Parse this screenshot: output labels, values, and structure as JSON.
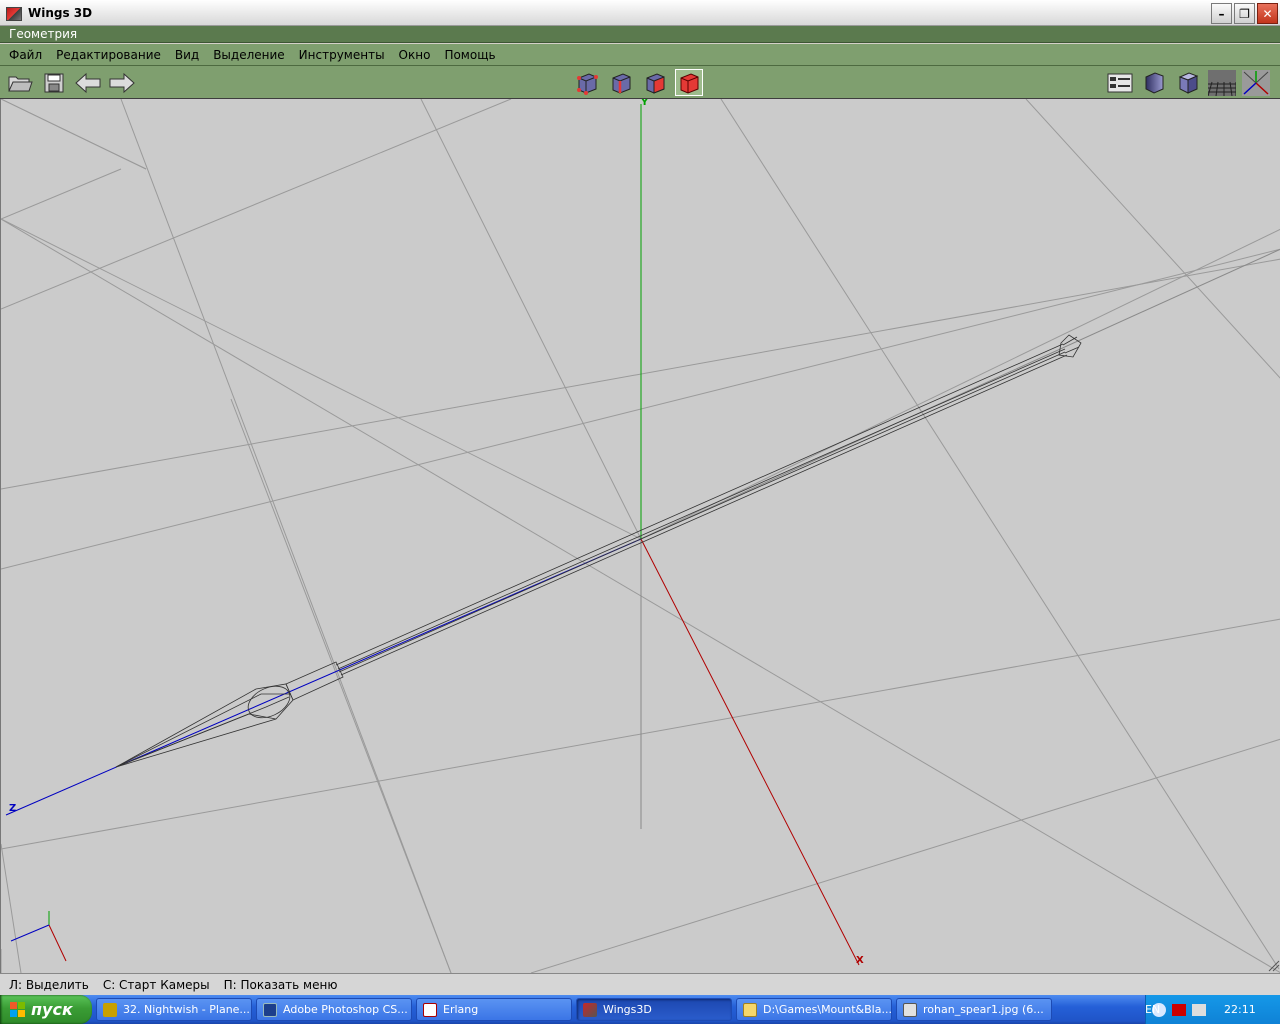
{
  "window": {
    "title": "Wings 3D"
  },
  "geometry_bar": {
    "label": "Геометрия"
  },
  "menu": [
    {
      "label": "Файл"
    },
    {
      "label": "Редактирование"
    },
    {
      "label": "Вид"
    },
    {
      "label": "Выделение"
    },
    {
      "label": "Инструменты"
    },
    {
      "label": "Окно"
    },
    {
      "label": "Помощь"
    }
  ],
  "toolbar": {
    "left_icons": [
      "open-icon",
      "save-icon",
      "undo-icon",
      "redo-icon"
    ],
    "select_modes": [
      "vertex-select-icon",
      "edge-select-icon",
      "face-select-icon",
      "object-select-icon"
    ],
    "active_select_mode": "object-select-icon",
    "right_icons": [
      "outliner-icon",
      "smooth-shade-icon",
      "flat-shade-icon",
      "ground-grid-icon",
      "axes-icon"
    ],
    "colors": {
      "accent": "#7f9f6f",
      "active_cube": "#e53935"
    }
  },
  "viewport": {
    "axis_labels": {
      "x": "X",
      "y": "Y",
      "z": "Z"
    },
    "axis_colors": {
      "x": "#b00000",
      "y": "#00a000",
      "z": "#0000c0"
    },
    "background": "#cbcbcb"
  },
  "status": {
    "items": [
      "Л: Выделить",
      "С: Старт Камеры",
      "П: Показать меню"
    ]
  },
  "taskbar": {
    "start_label": "пуск",
    "tasks": [
      {
        "label": "32. Nightwish - Plane...",
        "icon": "winamp-icon",
        "active": false
      },
      {
        "label": "Adobe Photoshop CS...",
        "icon": "photoshop-icon",
        "active": false
      },
      {
        "label": "Erlang",
        "icon": "erlang-icon",
        "active": false
      },
      {
        "label": "Wings3D",
        "icon": "wings-icon",
        "active": true
      },
      {
        "label": "D:\\Games\\Mount&Bla...",
        "icon": "folder-icon",
        "active": false
      },
      {
        "label": "rohan_spear1.jpg (6...",
        "icon": "image-icon",
        "active": false
      }
    ],
    "language": "EN",
    "clock": "22:11"
  }
}
